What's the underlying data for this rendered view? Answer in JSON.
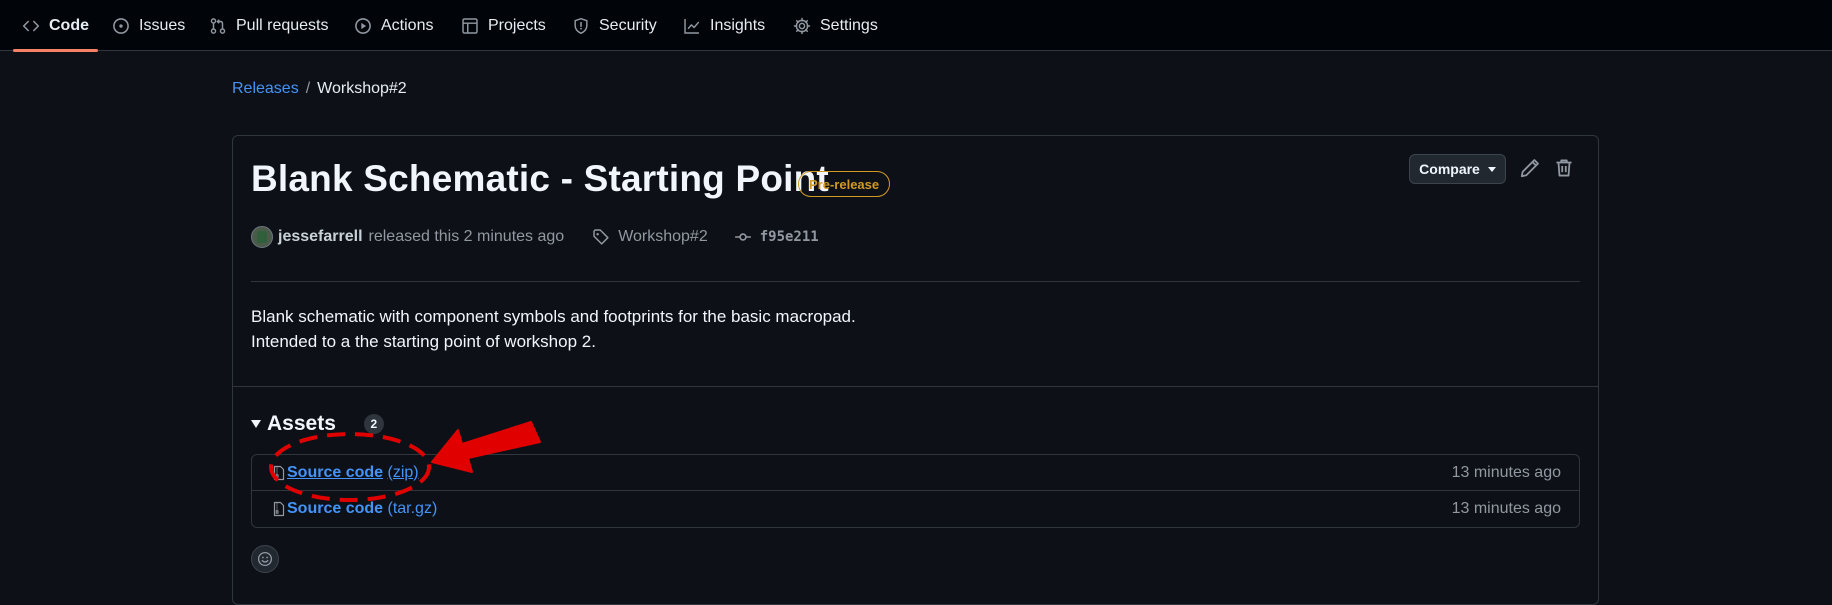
{
  "nav": {
    "items": [
      {
        "label": "Code",
        "icon": "code-icon"
      },
      {
        "label": "Issues",
        "icon": "issue-icon"
      },
      {
        "label": "Pull requests",
        "icon": "pull-request-icon"
      },
      {
        "label": "Actions",
        "icon": "play-icon"
      },
      {
        "label": "Projects",
        "icon": "table-icon"
      },
      {
        "label": "Security",
        "icon": "shield-icon"
      },
      {
        "label": "Insights",
        "icon": "graph-icon"
      },
      {
        "label": "Settings",
        "icon": "gear-icon"
      }
    ],
    "active": "Code"
  },
  "breadcrumb": {
    "parent": "Releases",
    "separator": "/",
    "current": "Workshop#2"
  },
  "release": {
    "title": "Blank Schematic - Starting Point",
    "badge": "Pre-release",
    "compare_label": "Compare",
    "author": "jessefarrell",
    "released_text": "released this 2 minutes ago",
    "tag": "Workshop#2",
    "commit": "f95e211",
    "body_line1": "Blank schematic with component symbols and footprints for the basic macropad.",
    "body_line2": "Intended to a the starting point of workshop 2."
  },
  "assets": {
    "label": "Assets",
    "count": "2",
    "items": [
      {
        "name": "Source code",
        "ext": "(zip)",
        "time": "13 minutes ago"
      },
      {
        "name": "Source code",
        "ext": "(tar.gz)",
        "time": "13 minutes ago"
      }
    ]
  },
  "colors": {
    "accent": "#f78166",
    "link": "#4493f8",
    "prerelease": "#d29922",
    "annotation": "#e00000"
  }
}
